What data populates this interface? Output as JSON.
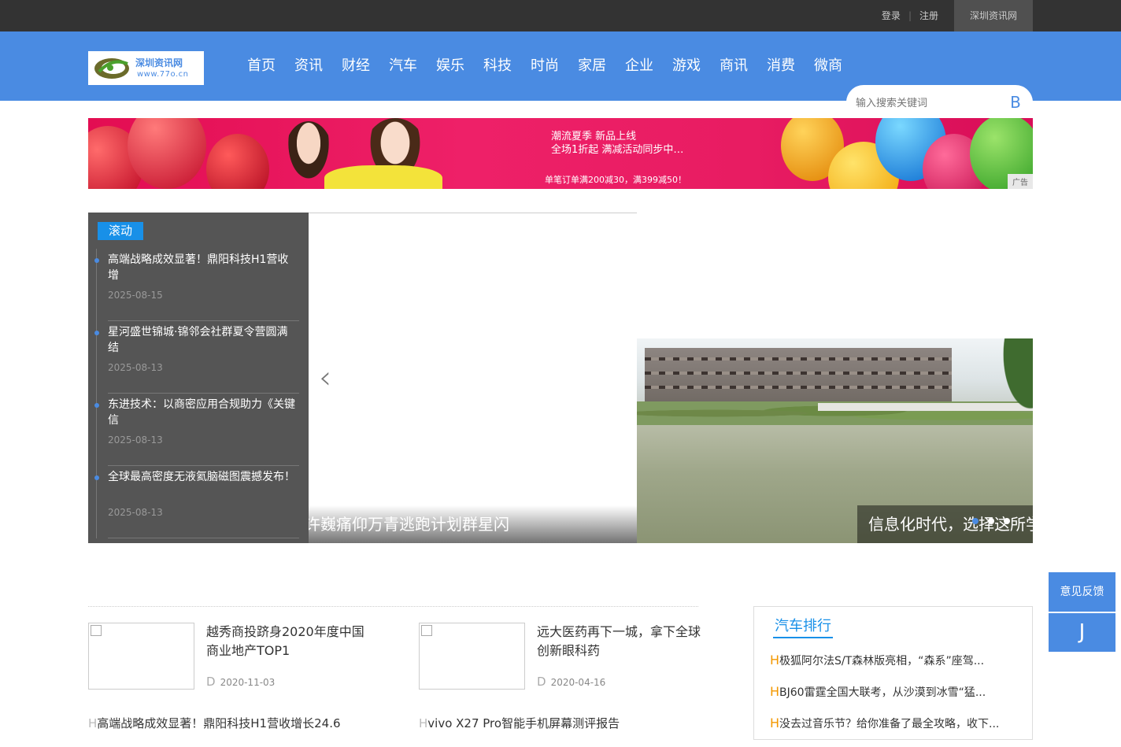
{
  "topbar": {
    "login": "登录",
    "register": "注册",
    "site_name": "深圳资讯网"
  },
  "logo": {
    "name": "深圳资讯网",
    "url": "www.77o.cn"
  },
  "nav": [
    "首页",
    "资讯",
    "财经",
    "汽车",
    "娱乐",
    "科技",
    "时尚",
    "家居",
    "企业",
    "游戏",
    "商讯",
    "消费",
    "微商"
  ],
  "search": {
    "placeholder": "输入搜索关键词",
    "button": "B"
  },
  "banner": {
    "line1": "潮流夏季  新品上线",
    "line2": "全场1折起  满减活动同步中…",
    "line3": "单笔订单满200减30，满399减50！",
    "ad_tag": "广告"
  },
  "scroll": {
    "tag": "滚动",
    "items": [
      {
        "title": "高端战略成效显著！鼎阳科技H1营收增",
        "date": "2025-08-15"
      },
      {
        "title": "星河盛世锦城·锦邻会社群夏令营圆满结",
        "date": "2025-08-13"
      },
      {
        "title": "东进技术：以商密应用合规助力《关键信",
        "date": "2025-08-13"
      },
      {
        "title": "全球最高密度无液氦脑磁图震撼发布！",
        "date": "2025-08-13"
      }
    ]
  },
  "slider": {
    "caption1": "许巍痛仰万青逃跑计划群星闪",
    "caption2": "信息化时代，选择这所学",
    "arrow": "‹"
  },
  "cards": [
    {
      "title": "越秀商投跻身2020年度中国商业地产TOP1",
      "date": "2020-11-03",
      "date_icon": "D"
    },
    {
      "title": "远大医药再下一城，拿下全球创新眼科药",
      "date": "2020-04-16",
      "date_icon": "D"
    }
  ],
  "headlines": [
    {
      "icon": "H",
      "text": "高端战略成效显著！鼎阳科技H1营收增长24.6"
    },
    {
      "icon": "H",
      "text": "vivo X27 Pro智能手机屏幕测评报告"
    }
  ],
  "rank": {
    "title": "汽车排行",
    "items": [
      {
        "icon": "H",
        "text": "极狐阿尔法S/T森林版亮相，“森系”座驾..."
      },
      {
        "icon": "H",
        "text": "BJ60雷霆全国大联考，从沙漠到冰雪“猛..."
      },
      {
        "icon": "H",
        "text": "没去过音乐节？给你准备了最全攻略，收下..."
      }
    ]
  },
  "feedback": {
    "label": "意见反馈",
    "icon": "J"
  },
  "colors": {
    "topbar": "#333333",
    "nav": "#4a8be2",
    "accent": "#1890e8",
    "rank_icon": "#f39800"
  }
}
